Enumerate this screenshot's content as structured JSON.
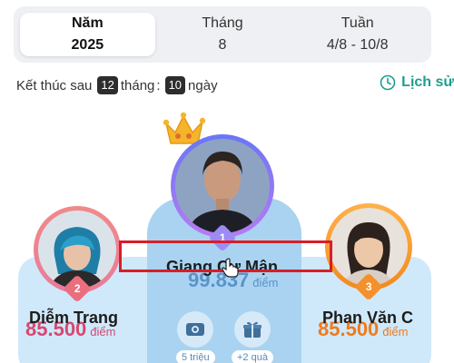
{
  "tabs": [
    {
      "label": "Năm",
      "value": "2025",
      "active": true
    },
    {
      "label": "Tháng",
      "value": "8",
      "active": false
    },
    {
      "label": "Tuần",
      "value": "4/8 - 10/8",
      "active": false
    }
  ],
  "countdown": {
    "prefix": "Kết thúc sau",
    "months_num": "12",
    "months_label": "tháng",
    "separator": ":",
    "days_num": "10",
    "days_label": "ngày"
  },
  "history": {
    "label": "Lịch sử",
    "icon": "clock-icon"
  },
  "leaders": [
    {
      "rank": "1",
      "name": "Giang Cư Mận",
      "score": "99.837",
      "unit": "điểm",
      "color": "#5a93c8"
    },
    {
      "rank": "2",
      "name": "Diễm Trang",
      "score": "85.500",
      "unit": "điểm",
      "color": "#d9476f"
    },
    {
      "rank": "3",
      "name": "Phan Văn C",
      "score": "85.500",
      "unit": "điểm",
      "color": "#f07a1a"
    }
  ],
  "prizes": [
    {
      "label": "5 triệu",
      "icon": "money-icon"
    },
    {
      "label": "+2 quà",
      "icon": "gift-icon"
    }
  ],
  "colors": {
    "accent": "#1b9e8f",
    "highlight": "#d81e27",
    "podium": "#cfe9fb",
    "podium_center": "#a9d3f1"
  }
}
